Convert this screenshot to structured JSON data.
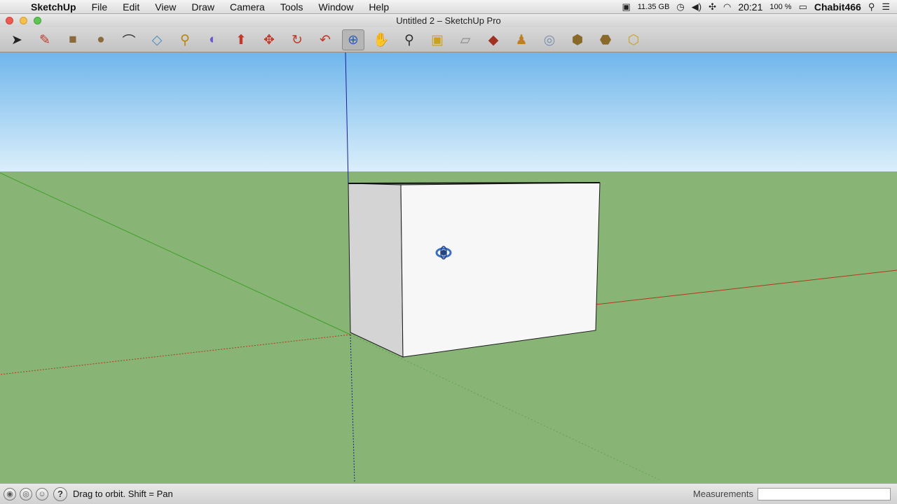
{
  "menubar": {
    "apple_icon": "apple-icon",
    "app_name": "SketchUp",
    "items": [
      "File",
      "Edit",
      "View",
      "Draw",
      "Camera",
      "Tools",
      "Window",
      "Help"
    ],
    "disk_space": "11.35 GB",
    "clock": "20:21",
    "battery": "100 %",
    "user": "Chabit466"
  },
  "window": {
    "title": "Untitled 2 – SketchUp Pro"
  },
  "toolbar": {
    "tools": [
      {
        "name": "select-tool",
        "glyph": "➤"
      },
      {
        "name": "pencil-tool",
        "glyph": "✎"
      },
      {
        "name": "rectangle-tool",
        "glyph": "■"
      },
      {
        "name": "circle-tool",
        "glyph": "●"
      },
      {
        "name": "arc-tool",
        "glyph": "⌒"
      },
      {
        "name": "eraser-tool",
        "glyph": "◇"
      },
      {
        "name": "tape-measure-tool",
        "glyph": "⚲"
      },
      {
        "name": "paint-bucket-tool",
        "glyph": "◐"
      },
      {
        "name": "push-pull-tool",
        "glyph": "⬆"
      },
      {
        "name": "move-tool",
        "glyph": "✥"
      },
      {
        "name": "rotate-tool",
        "glyph": "↻"
      },
      {
        "name": "follow-me-tool",
        "glyph": "↶"
      },
      {
        "name": "orbit-tool",
        "glyph": "⊕",
        "active": true
      },
      {
        "name": "pan-tool",
        "glyph": "✋"
      },
      {
        "name": "zoom-tool",
        "glyph": "⚲"
      },
      {
        "name": "zoom-extents-tool",
        "glyph": "▣"
      },
      {
        "name": "previous-view-tool",
        "glyph": "▱"
      },
      {
        "name": "add-location-tool",
        "glyph": "◆"
      },
      {
        "name": "position-camera-tool",
        "glyph": "♟"
      },
      {
        "name": "get-models-tool",
        "glyph": "◎"
      },
      {
        "name": "share-model-tool",
        "glyph": "⬢"
      },
      {
        "name": "get-components-tool",
        "glyph": "⬣"
      },
      {
        "name": "share-component-tool",
        "glyph": "⬡"
      }
    ]
  },
  "colors": {
    "sky_top": "#6fb6ec",
    "sky_horizon": "#dbeffa",
    "ground": "#88b476",
    "box_front": "#f7f7f7",
    "box_side": "#d4d4d4",
    "axis_red": "#b03a1a",
    "axis_green": "#3fa028",
    "axis_blue": "#1d1d9a"
  },
  "statusbar": {
    "icons": [
      "geo-location-icon",
      "credits-icon",
      "user-signin-icon"
    ],
    "message": "Drag to orbit.  Shift = Pan",
    "measurements_label": "Measurements",
    "measurements_value": ""
  }
}
